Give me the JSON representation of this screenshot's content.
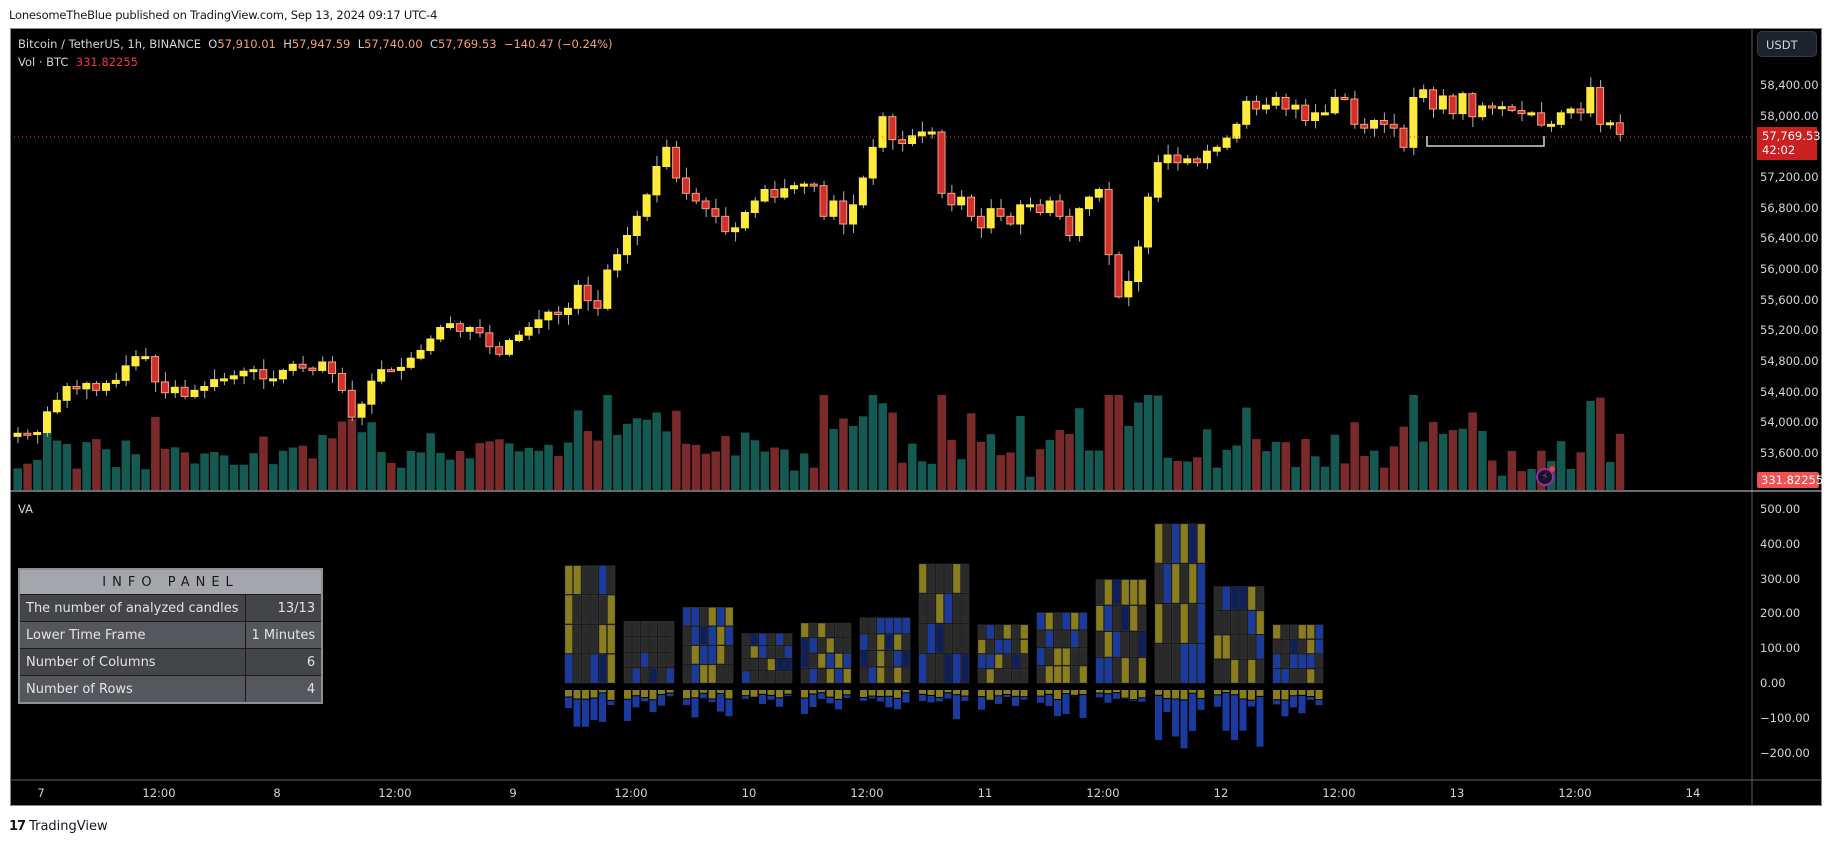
{
  "publish_line": "LonesomeTheBlue published on TradingView.com, Sep 13, 2024 09:17 UTC-4",
  "legend": {
    "symbol": "Bitcoin / TetherUS, 1h, BINANCE",
    "open_label": "O",
    "open": "57,910.01",
    "high_label": "H",
    "high": "57,947.59",
    "low_label": "L",
    "low": "57,740.00",
    "close_label": "C",
    "close": "57,769.53",
    "change": "−140.47 (−0.24%)",
    "vol_label": "Vol · BTC",
    "vol_value": "331.82255"
  },
  "indicator_label": "VA",
  "currency_button": "USDT",
  "price_tag": {
    "price": "57,769.53",
    "countdown": "42:02"
  },
  "volume_tag": "331.82255",
  "info_panel": {
    "title": "INFO PANEL",
    "rows": [
      {
        "label": "The number of analyzed candles",
        "value": "13/13"
      },
      {
        "label": "Lower Time Frame",
        "value": "1 Minutes"
      },
      {
        "label": "Number of Columns",
        "value": "6"
      },
      {
        "label": "Number of Rows",
        "value": "4"
      }
    ]
  },
  "footer_brand": "TradingView",
  "footer_mark": "17",
  "colors": {
    "bull": "#ffeb3b",
    "bear": "#d32f2f",
    "bear_border": "#f7a072",
    "wick": "#b2b5be",
    "vol_bull": "#145a52",
    "vol_bear": "#7a2a2a",
    "price_line": "#f23645",
    "va_blue": "#1a3a9e",
    "va_yellow": "#8a7d1e",
    "grid_cell": "#2a2a2a"
  },
  "chart_data": [
    {
      "type": "candlestick",
      "title": "Bitcoin / TetherUS, 1h, BINANCE",
      "ylabel": "USDT",
      "ylim": [
        53200,
        58900
      ],
      "y_ticks": [
        "58,400.00",
        "58,000.00",
        "57,200.00",
        "56,800.00",
        "56,400.00",
        "56,000.00",
        "55,600.00",
        "55,200.00",
        "54,800.00",
        "54,400.00",
        "54,000.00",
        "53,600.00"
      ],
      "x_ticks": [
        "7",
        "12:00",
        "8",
        "12:00",
        "9",
        "12:00",
        "10",
        "12:00",
        "11",
        "12:00",
        "12",
        "12:00",
        "13",
        "12:00",
        "14"
      ],
      "last_price": 57769.53,
      "closes": [
        53870,
        53860,
        53880,
        54150,
        54300,
        54480,
        54450,
        54520,
        54430,
        54520,
        54560,
        54750,
        54870,
        54870,
        54540,
        54400,
        54470,
        54350,
        54430,
        54480,
        54570,
        54580,
        54620,
        54680,
        54700,
        54580,
        54580,
        54690,
        54770,
        54720,
        54690,
        54800,
        54650,
        54430,
        54080,
        54250,
        54550,
        54700,
        54690,
        54730,
        54850,
        54950,
        55100,
        55250,
        55300,
        55200,
        55250,
        55180,
        55000,
        54900,
        55080,
        55150,
        55250,
        55350,
        55450,
        55420,
        55500,
        55800,
        55600,
        55500,
        56000,
        56200,
        56450,
        56700,
        56980,
        57350,
        57600,
        57200,
        57000,
        56900,
        56800,
        56700,
        56500,
        56550,
        56750,
        56900,
        57050,
        56950,
        57060,
        57100,
        57120,
        57100,
        56700,
        56900,
        56600,
        56850,
        57200,
        57600,
        58000,
        57700,
        57650,
        57750,
        57800,
        57800,
        57000,
        56850,
        56950,
        56700,
        56550,
        56800,
        56700,
        56600,
        56850,
        56850,
        56750,
        56900,
        56700,
        56450,
        56800,
        56950,
        57050,
        56200,
        55650,
        55850,
        56300,
        56950,
        57400,
        57500,
        57400,
        57450,
        57400,
        57550,
        57600,
        57720,
        57900,
        58200,
        58100,
        58150,
        58250,
        58100,
        58150,
        57950,
        58050,
        58050,
        58250,
        58230,
        57900,
        57850,
        57950,
        57900,
        57850,
        57600,
        58250,
        58350,
        58100,
        58270,
        58040,
        58300,
        58000,
        58140,
        58130,
        58130,
        58080,
        58040,
        58050,
        57890,
        57900,
        58050,
        58100,
        58050,
        58380,
        57900,
        57920,
        57770
      ],
      "volume_series": "per-candle bars, bull/bear colored"
    },
    {
      "type": "heatmap",
      "title": "VA",
      "ylim": [
        -250,
        560
      ],
      "y_ticks": [
        "500.00",
        "400.00",
        "300.00",
        "200.00",
        "100.00",
        "0.00",
        "−100.00",
        "−200.00"
      ],
      "blocks": [
        {
          "top": 340,
          "bottom_bar": -130
        },
        {
          "top": 180,
          "bottom_bar": -80
        },
        {
          "top": 220,
          "bottom_bar": -75
        },
        {
          "top": 145,
          "bottom_bar": -35
        },
        {
          "top": 175,
          "bottom_bar": -60
        },
        {
          "top": 190,
          "bottom_bar": -40
        },
        {
          "top": 345,
          "bottom_bar": -90
        },
        {
          "top": 170,
          "bottom_bar": -50
        },
        {
          "top": 205,
          "bottom_bar": -95
        },
        {
          "top": 300,
          "bottom_bar": -60
        },
        {
          "top": 460,
          "bottom_bar": -180
        },
        {
          "top": 280,
          "bottom_bar": -200
        },
        {
          "top": 170,
          "bottom_bar": -75
        }
      ]
    }
  ]
}
